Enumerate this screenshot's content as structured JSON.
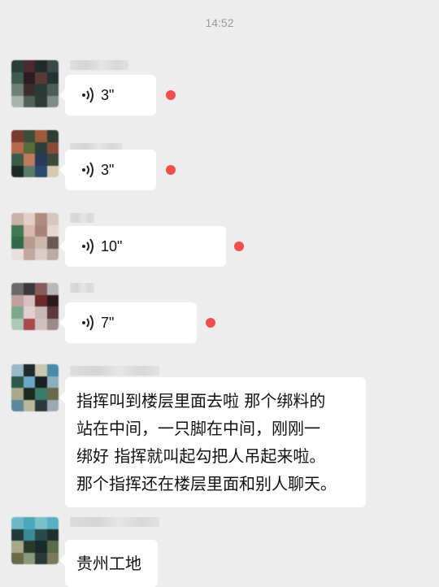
{
  "header": {
    "time": "14:52"
  },
  "messages": [
    {
      "type": "voice",
      "duration": "3\"",
      "unread": true
    },
    {
      "type": "voice",
      "duration": "3\"",
      "unread": true
    },
    {
      "type": "voice",
      "duration": "10\"",
      "unread": true
    },
    {
      "type": "voice",
      "duration": "7\"",
      "unread": true
    },
    {
      "type": "text",
      "lines": [
        "指挥叫到楼层里面去啦 那个绑料的",
        "站在中间，一只脚在中间，刚刚一",
        "绑好 指挥就叫起勾把人吊起来啦。",
        "那个指挥还在楼层里面和别人聊天。"
      ]
    },
    {
      "type": "text",
      "lines": [
        "贵州工地"
      ]
    }
  ],
  "colors": {
    "unread_dot": "#f24d4b",
    "background": "#ededed",
    "bubble": "#ffffff"
  },
  "icons": {
    "voice": "voice-wave-icon"
  }
}
